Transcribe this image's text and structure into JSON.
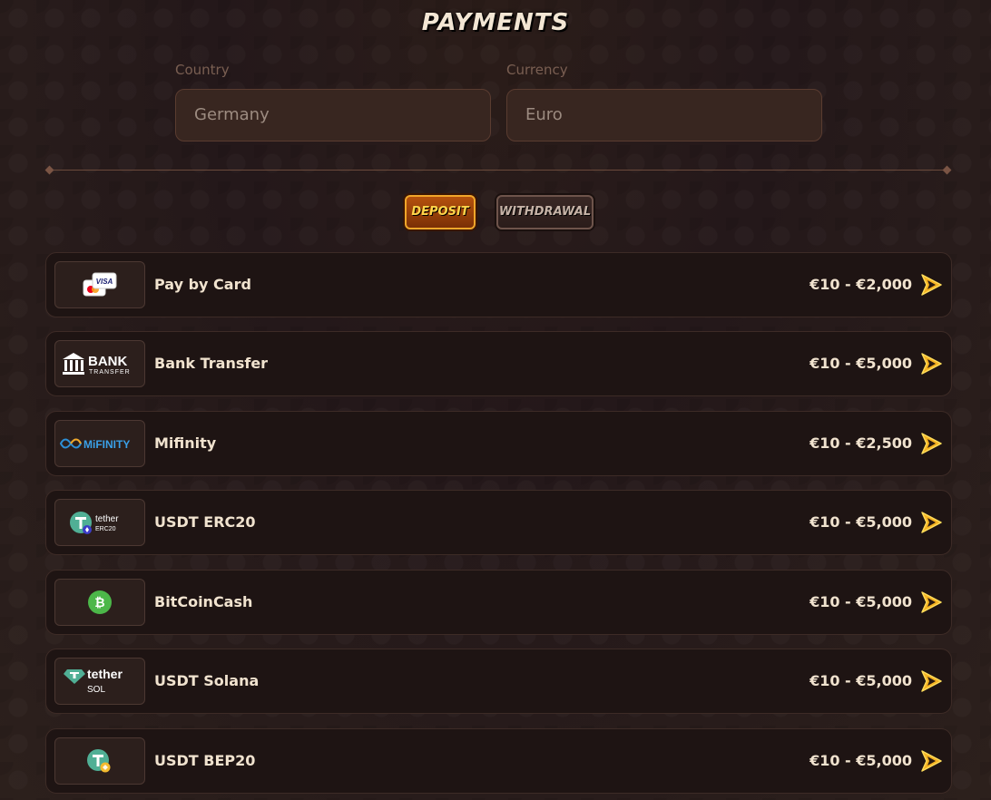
{
  "page": {
    "title": "PAYMENTS"
  },
  "country": {
    "label": "Country",
    "value": "Germany"
  },
  "currency": {
    "label": "Currency",
    "value": "Euro"
  },
  "tabs": {
    "deposit": "DEPOSIT",
    "withdrawal": "WITHDRAWAL"
  },
  "logos": {
    "visa_text": "VISA",
    "bank_title": "BANK",
    "bank_sub": "TRANSFER",
    "mifinity_text": "MiFINITY",
    "tether_text": "tether",
    "erc20_text": "ERC20",
    "sol_text": "SOL"
  },
  "methods": [
    {
      "name": "Pay by Card",
      "range": "€10 - €2,000",
      "icon": "card-logo-icon"
    },
    {
      "name": "Bank Transfer",
      "range": "€10 - €5,000",
      "icon": "bank-transfer-logo-icon"
    },
    {
      "name": "Mifinity",
      "range": "€10 - €2,500",
      "icon": "mifinity-logo-icon"
    },
    {
      "name": "USDT ERC20",
      "range": "€10 - €5,000",
      "icon": "tether-erc20-logo-icon"
    },
    {
      "name": "BitCoinCash",
      "range": "€10 - €5,000",
      "icon": "bitcoincash-logo-icon"
    },
    {
      "name": "USDT Solana",
      "range": "€10 - €5,000",
      "icon": "tether-sol-logo-icon"
    },
    {
      "name": "USDT BEP20",
      "range": "€10 - €5,000",
      "icon": "tether-bep20-logo-icon"
    }
  ],
  "colors": {
    "accent": "#f0a62a",
    "row_bg": "#1e1413",
    "page_bg": "#2a1d1a"
  }
}
